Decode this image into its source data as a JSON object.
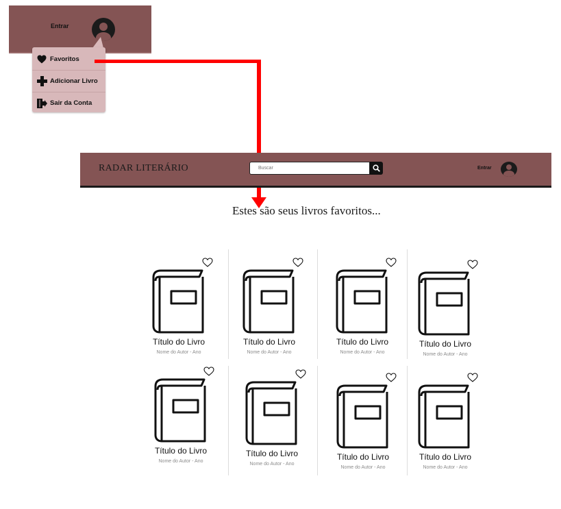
{
  "colors": {
    "brand": "#845454",
    "menu_bg": "#d8b8ba",
    "connector": "#ff0000"
  },
  "mini_header": {
    "login_label": "Entrar",
    "menu": [
      {
        "label": "Favoritos",
        "icon": "heart-icon"
      },
      {
        "label": "Adicionar Livro",
        "icon": "plus-icon"
      },
      {
        "label": "Sair da Conta",
        "icon": "logout-icon"
      }
    ]
  },
  "navbar": {
    "brand": "RADAR LITERÁRIO",
    "search_placeholder": "Buscar",
    "search_icon": "search-icon",
    "login_label": "Entrar"
  },
  "main": {
    "heading": "Estes são seus livros favoritos...",
    "books": [
      {
        "title": "Título do Livro",
        "author": "Nome do Autor - Ano"
      },
      {
        "title": "Título do Livro",
        "author": "Nome do Autor - Ano"
      },
      {
        "title": "Título do Livro",
        "author": "Nome do Autor - Ano"
      },
      {
        "title": "Título do Livro",
        "author": "Nome do Autor - Ano"
      },
      {
        "title": "Título do Livro",
        "author": "Nome do Autor - Ano"
      },
      {
        "title": "Título do Livro",
        "author": "Nome do Autor - Ano"
      },
      {
        "title": "Título do Livro",
        "author": "Nome do Autor - Ano"
      },
      {
        "title": "Título do Livro",
        "author": "Nome do Autor - Ano"
      }
    ]
  }
}
